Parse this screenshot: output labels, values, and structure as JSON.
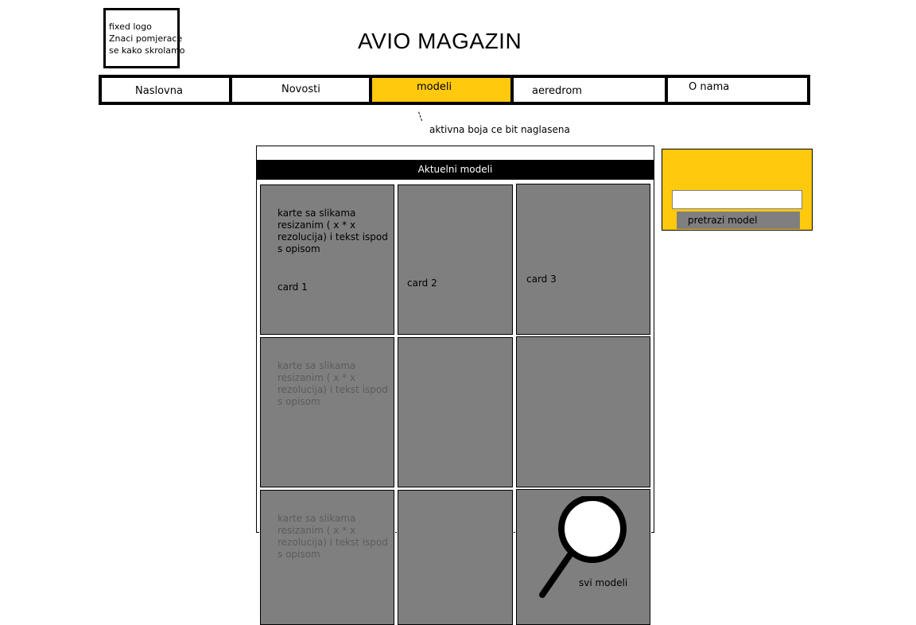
{
  "logo": {
    "lines": [
      "fixed logo",
      "Znaci pomjerace",
      "se kako skrolamo"
    ]
  },
  "site_title": "AVIO MAGAZIN",
  "nav": {
    "items": [
      {
        "label": "Naslovna",
        "active": false
      },
      {
        "label": "Novosti",
        "active": false
      },
      {
        "label": "modeli",
        "active": true
      },
      {
        "label": "aeredrom",
        "active": false
      },
      {
        "label": "O nama",
        "active": false
      }
    ],
    "active_note": "aktivna boja ce bit naglasena"
  },
  "panel": {
    "header": "Aktuelni modeli"
  },
  "cards": {
    "description": "karte sa slikama resizanim ( x * x rezolucija) i tekst ispod s opisom",
    "labels": [
      "card 1",
      "card 2",
      "card 3"
    ],
    "all_models_label": "svi modeli"
  },
  "search": {
    "input_value": "",
    "button_label": "pretrazi model"
  },
  "colors": {
    "accent": "#ffc90e",
    "card": "#7f7f7f",
    "header": "#000000"
  }
}
